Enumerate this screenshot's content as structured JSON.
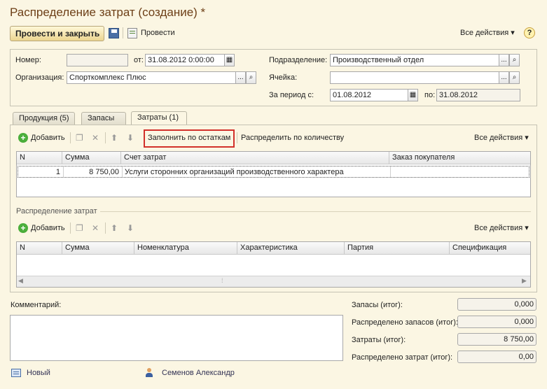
{
  "window": {
    "title": "Распределение затрат (создание) *"
  },
  "toolbar": {
    "post_close_label": "Провести и закрыть",
    "post_label": "Провести",
    "all_actions_label": "Все действия",
    "help_label": "?"
  },
  "header": {
    "number_label": "Номер:",
    "number_value": "",
    "from_label": "от:",
    "date_value": "31.08.2012  0:00:00",
    "org_label": "Организация:",
    "org_value": "Спорткомплекс Плюс",
    "dept_label": "Подразделение:",
    "dept_value": "Производственный отдел",
    "cell_label": "Ячейка:",
    "cell_value": "",
    "period_label": "За период с:",
    "period_from": "01.08.2012",
    "period_to_label": "по:",
    "period_to": "31.08.2012"
  },
  "tabs": [
    {
      "label": "Продукция (5)"
    },
    {
      "label": "Запасы"
    },
    {
      "label": "Затраты (1)"
    }
  ],
  "costs_toolbar": {
    "add_label": "Добавить",
    "fill_label": "Заполнить по остаткам",
    "distribute_label": "Распределить по количеству",
    "all_actions_label": "Все действия"
  },
  "costs_table": {
    "columns": [
      "N",
      "Сумма",
      "Счет затрат",
      "Заказ покупателя"
    ],
    "rows": [
      {
        "n": "1",
        "sum": "8 750,00",
        "account": "Услуги сторонних организаций производственного характера",
        "order": ""
      }
    ]
  },
  "distribution": {
    "section_label": "Распределение затрат",
    "add_label": "Добавить",
    "all_actions_label": "Все действия",
    "columns": [
      "N",
      "Сумма",
      "Номенклатура",
      "Характеристика",
      "Партия",
      "Спецификация"
    ]
  },
  "footer": {
    "comment_label": "Комментарий:",
    "comment_value": "",
    "totals": [
      {
        "label": "Запасы (итог):",
        "value": "0,000"
      },
      {
        "label": "Распределено запасов (итог):",
        "value": "0,000"
      },
      {
        "label": "Затраты (итог):",
        "value": "8 750,00"
      },
      {
        "label": "Распределено затрат (итог):",
        "value": "0,00"
      }
    ]
  },
  "status": {
    "state_label": "Новый",
    "user_label": "Семенов Александр"
  },
  "colors": {
    "background": "#fbf6e3",
    "title": "#6d3f17",
    "highlight_border": "#d2302a"
  }
}
